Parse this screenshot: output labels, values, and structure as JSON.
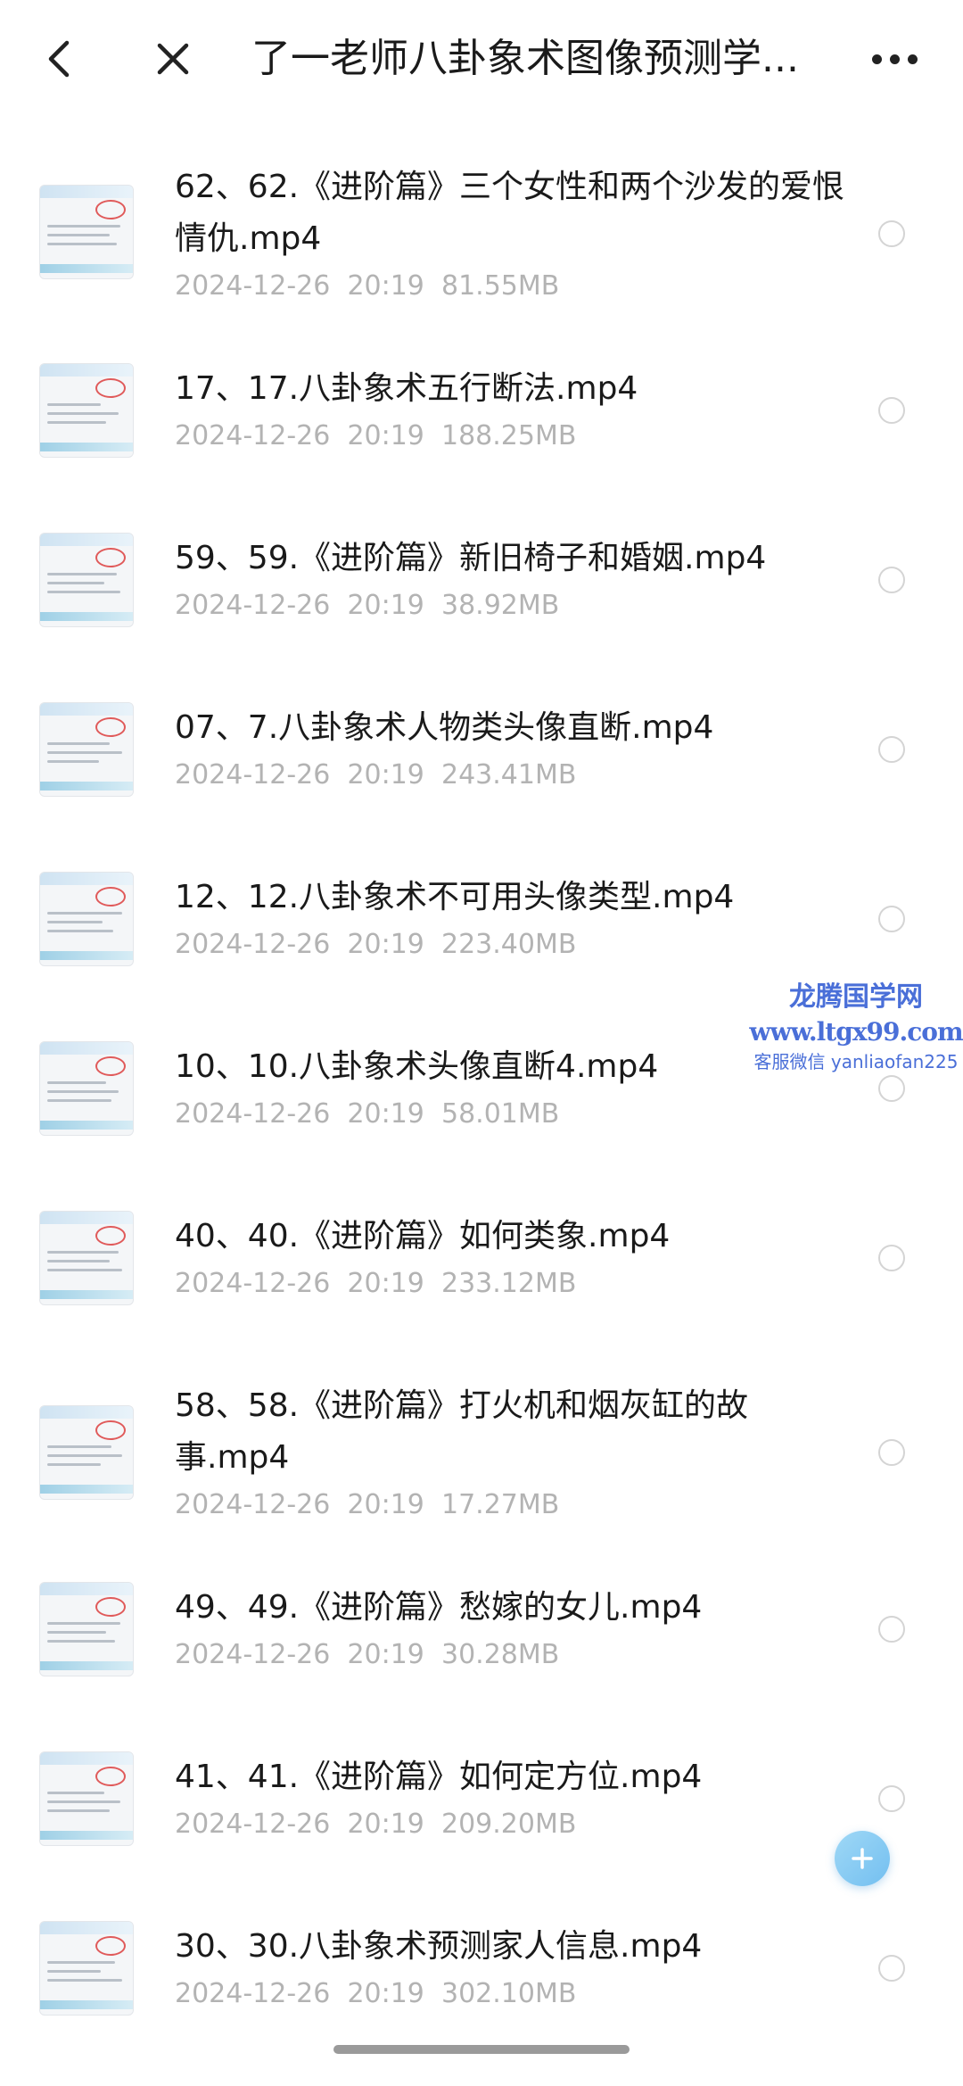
{
  "header": {
    "title": "了一老师八卦象术图像预测学...",
    "back_icon": "chevron-left-icon",
    "close_icon": "close-icon",
    "more_icon": "more-dots-icon"
  },
  "files": [
    {
      "name": "62、62.《进阶篇》三个女性和两个沙发的爱恨情仇.mp4",
      "date": "2024-12-26",
      "time": "20:19",
      "size": "81.55MB"
    },
    {
      "name": "17、17.八卦象术五行断法.mp4",
      "date": "2024-12-26",
      "time": "20:19",
      "size": "188.25MB"
    },
    {
      "name": "59、59.《进阶篇》新旧椅子和婚姻.mp4",
      "date": "2024-12-26",
      "time": "20:19",
      "size": "38.92MB"
    },
    {
      "name": "07、7.八卦象术人物类头像直断.mp4",
      "date": "2024-12-26",
      "time": "20:19",
      "size": "243.41MB"
    },
    {
      "name": "12、12.八卦象术不可用头像类型.mp4",
      "date": "2024-12-26",
      "time": "20:19",
      "size": "223.40MB"
    },
    {
      "name": "10、10.八卦象术头像直断4.mp4",
      "date": "2024-12-26",
      "time": "20:19",
      "size": "58.01MB"
    },
    {
      "name": "40、40.《进阶篇》如何类象.mp4",
      "date": "2024-12-26",
      "time": "20:19",
      "size": "233.12MB"
    },
    {
      "name": "58、58.《进阶篇》打火机和烟灰缸的故事.mp4",
      "date": "2024-12-26",
      "time": "20:19",
      "size": "17.27MB"
    },
    {
      "name": "49、49.《进阶篇》愁嫁的女儿.mp4",
      "date": "2024-12-26",
      "time": "20:19",
      "size": "30.28MB"
    },
    {
      "name": "41、41.《进阶篇》如何定方位.mp4",
      "date": "2024-12-26",
      "time": "20:19",
      "size": "209.20MB"
    },
    {
      "name": "30、30.八卦象术预测家人信息.mp4",
      "date": "2024-12-26",
      "time": "20:19",
      "size": "302.10MB"
    }
  ],
  "watermark": {
    "site_name": "龙腾国学网",
    "url": "www.ltgx99.com",
    "contact": "客服微信 yanliaofan225"
  },
  "fab_icon": "plus-icon",
  "colors": {
    "text_primary": "#1a1a1a",
    "text_meta": "#b3b3b3",
    "watermark": "#4a6fd8",
    "fab": "#73bff0"
  }
}
